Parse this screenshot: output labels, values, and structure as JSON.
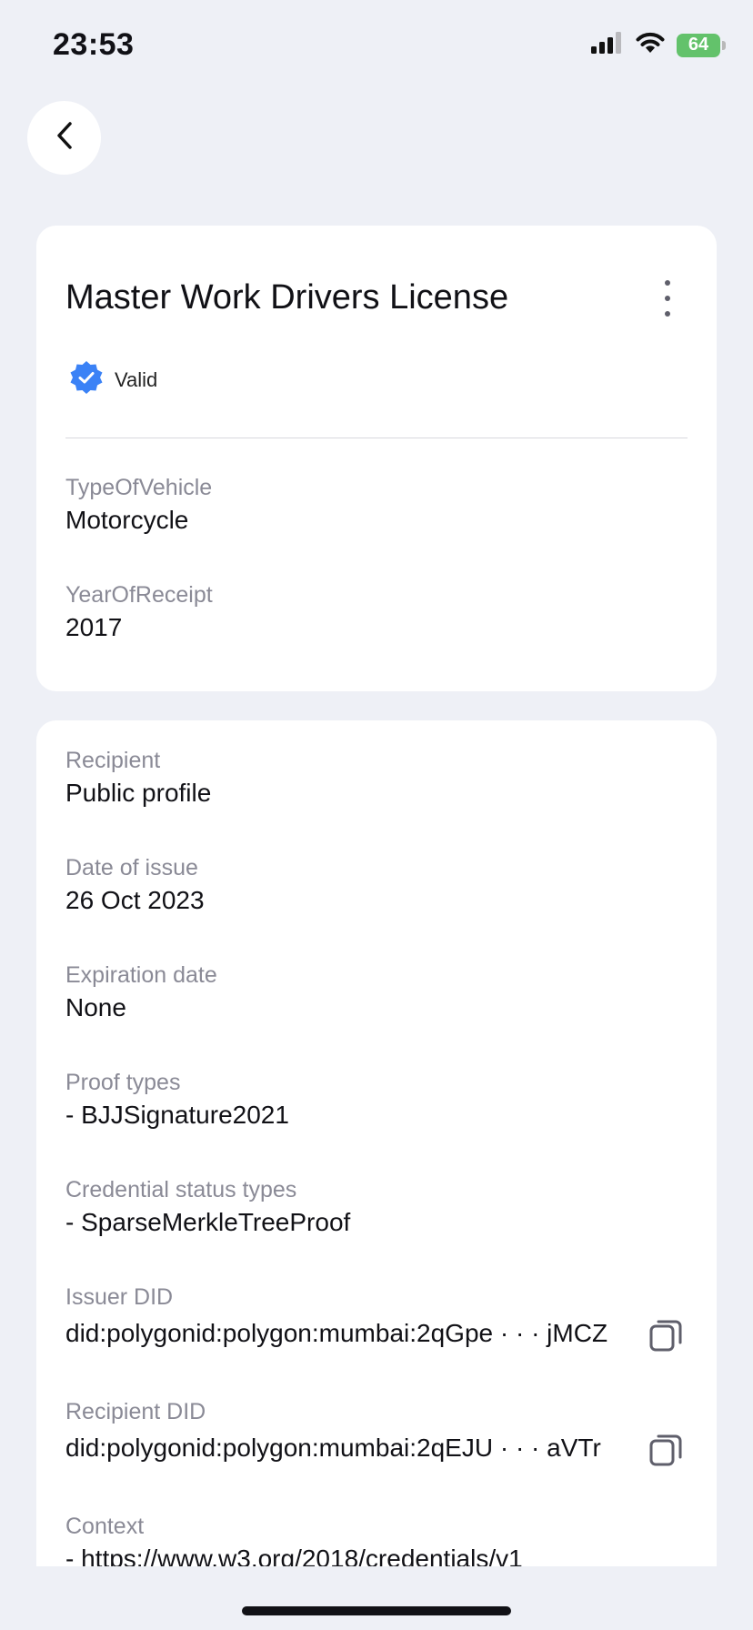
{
  "status_bar": {
    "time": "23:53",
    "battery": "64"
  },
  "credential": {
    "title": "Master Work Drivers License",
    "status": "Valid",
    "attributes": [
      {
        "label": "TypeOfVehicle",
        "value": "Motorcycle"
      },
      {
        "label": "YearOfReceipt",
        "value": "2017"
      }
    ]
  },
  "details": {
    "recipient": {
      "label": "Recipient",
      "value": "Public profile"
    },
    "date_of_issue": {
      "label": "Date of issue",
      "value": "26 Oct 2023"
    },
    "expiration_date": {
      "label": "Expiration date",
      "value": "None"
    },
    "proof_types": {
      "label": "Proof types",
      "value": "- BJJSignature2021"
    },
    "credential_status_types": {
      "label": "Credential status types",
      "value": "- SparseMerkleTreeProof"
    },
    "issuer_did": {
      "label": "Issuer DID",
      "value": "did:polygonid:polygon:mumbai:2qGpe · · · jMCZ"
    },
    "recipient_did": {
      "label": "Recipient DID",
      "value": "did:polygonid:polygon:mumbai:2qEJU · · · aVTr"
    },
    "context": {
      "label": "Context",
      "value": "- https://www.w3.org/2018/credentials/v1"
    }
  },
  "icons": {
    "back": "chevron-left-icon",
    "more": "more-vertical-icon",
    "valid": "verified-badge-icon",
    "copy": "copy-icon"
  },
  "colors": {
    "background": "#eef0f6",
    "card": "#ffffff",
    "label": "#8a8a96",
    "verified": "#3b82f6",
    "battery": "#63c26b"
  }
}
